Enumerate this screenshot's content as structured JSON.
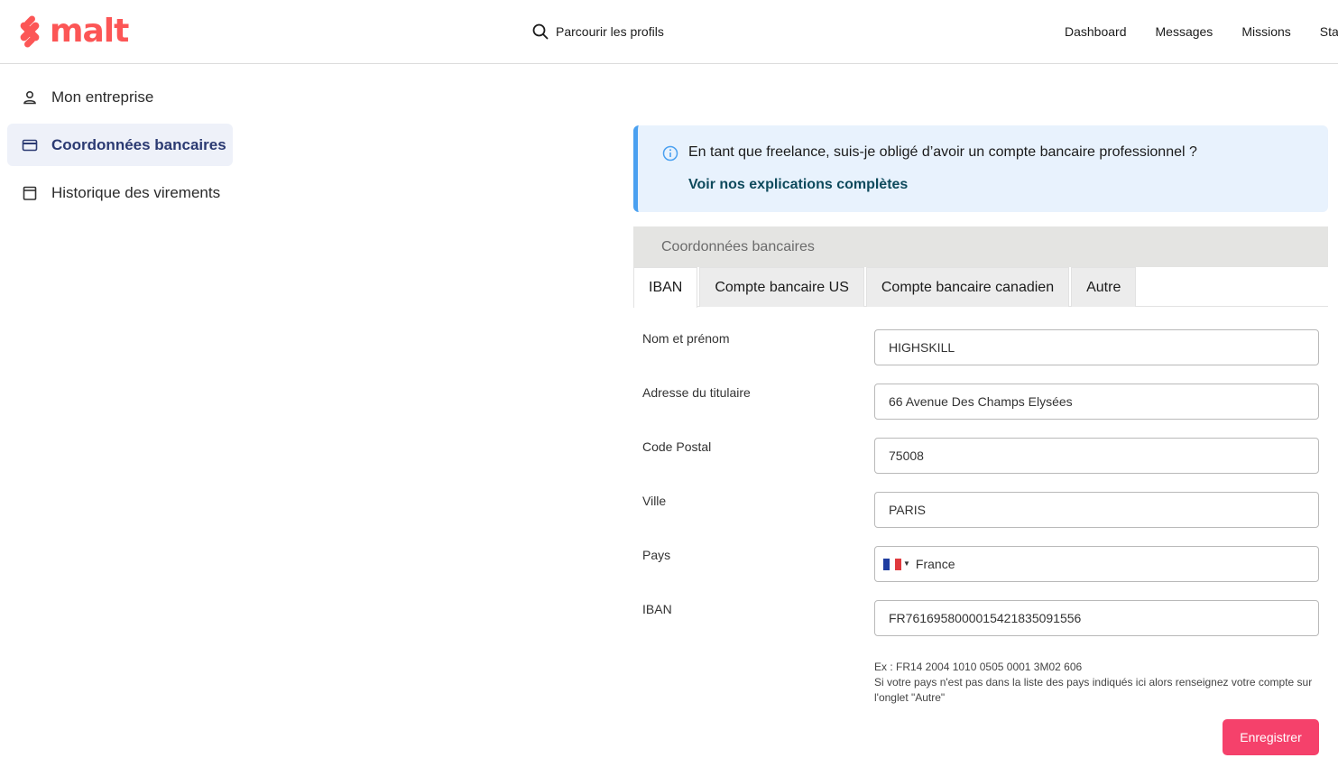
{
  "brand": {
    "name": "malt",
    "color": "#fc5656"
  },
  "header": {
    "browse_label": "Parcourir les profils",
    "nav": [
      "Dashboard",
      "Messages",
      "Missions",
      "Stat"
    ]
  },
  "sidebar": {
    "items": [
      {
        "label": "Mon entreprise",
        "icon": "person-icon",
        "active": false
      },
      {
        "label": "Coordonnées bancaires",
        "icon": "credit-card-icon",
        "active": true
      },
      {
        "label": "Historique des virements",
        "icon": "calendar-icon",
        "active": false
      }
    ]
  },
  "info": {
    "question": "En tant que freelance, suis-je obligé d’avoir un compte bancaire professionnel ?",
    "link": "Voir nos explications complètes"
  },
  "section": {
    "title": "Coordonnées bancaires",
    "tabs": [
      "IBAN",
      "Compte bancaire US",
      "Compte bancaire canadien",
      "Autre"
    ],
    "active_tab": "IBAN"
  },
  "form": {
    "name_label": "Nom et prénom",
    "name_value": "HIGHSKILL",
    "address_label": "Adresse du titulaire",
    "address_value": "66 Avenue Des Champs Elysées",
    "postal_label": "Code Postal",
    "postal_value": "75008",
    "city_label": "Ville",
    "city_value": "PARIS",
    "country_label": "Pays",
    "country_value": "France",
    "iban_label": "IBAN",
    "iban_value": "FR7616958000015421835091556",
    "hint_example": "Ex : FR14 2004 1010 0505 0001 3M02 606",
    "hint_text": "Si votre pays n'est pas dans la liste des pays indiqués ici alors renseignez votre compte sur l'onglet \"Autre\"",
    "save_label": "Enregistrer"
  },
  "colors": {
    "accent": "#f5416b",
    "info_bg": "#e8f2fd",
    "info_border": "#4aa0f0",
    "sidebar_active_bg": "#eef1f9",
    "sidebar_active_text": "#2b3a72"
  }
}
